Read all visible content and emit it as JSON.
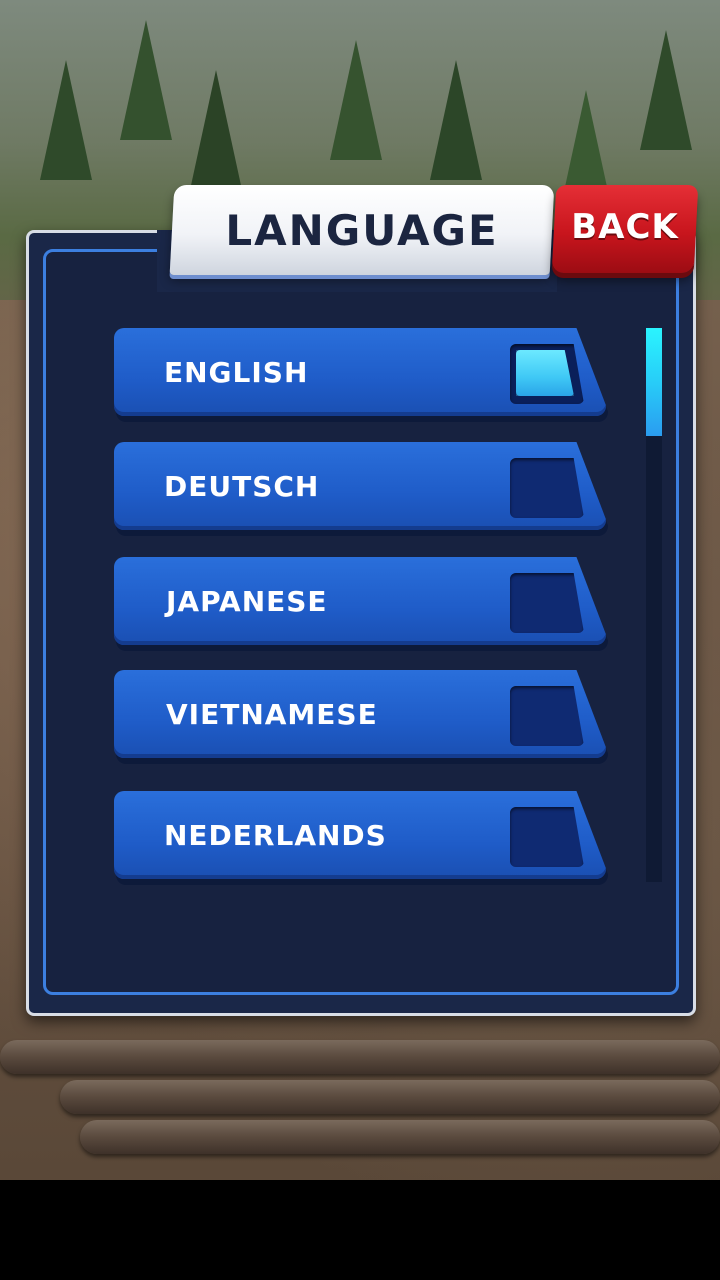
{
  "screen": {
    "title": "LANGUAGE",
    "back_label": "BACK"
  },
  "languages": [
    {
      "label": "ENGLISH",
      "selected": true
    },
    {
      "label": "DEUTSCH",
      "selected": false
    },
    {
      "label": "JAPANESE",
      "selected": false
    },
    {
      "label": "VIETNAMESE",
      "selected": false
    },
    {
      "label": "NEDERLANDS",
      "selected": false
    }
  ],
  "scrollbar": {
    "position_fraction": 0,
    "visible_fraction": 0.2
  },
  "colors": {
    "panel": "#1a2748",
    "row": "#1f5cc8",
    "selected_check": "#3fc8f5",
    "back_button": "#c8151d",
    "title_text": "#1b2540"
  }
}
